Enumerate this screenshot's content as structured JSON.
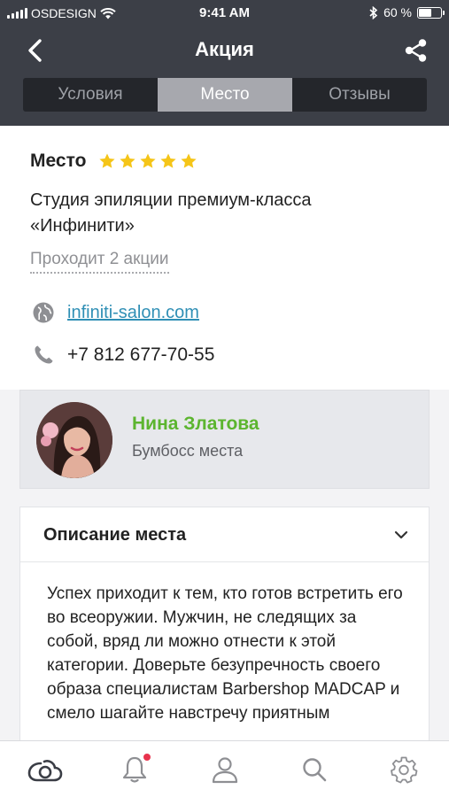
{
  "status_bar": {
    "carrier": "OSDESIGN",
    "time": "9:41 AM",
    "battery": "60 %"
  },
  "nav": {
    "title": "Акция"
  },
  "segments": [
    {
      "label": "Условия",
      "active": false
    },
    {
      "label": "Место",
      "active": true
    },
    {
      "label": "Отзывы",
      "active": false
    }
  ],
  "place": {
    "heading": "Место",
    "rating": 5,
    "name": "Студия эпиляции премиум-класса «Инфинити»",
    "promos_link": "Проходит 2 акции",
    "website": "infiniti-salon.com",
    "phone": "+7 812 677-70-55"
  },
  "boss": {
    "name": "Нина Златова",
    "role": "Бумбосс места"
  },
  "description": {
    "title": "Описание места",
    "text": "Успех приходит к тем, кто готов встретить его во всеоружии. Мужчин, не следящих за собой, вряд ли можно отнести к этой категории. Доверьте безупречность своего образа специалистам Barbershop MADCAP и смело шагайте навстречу приятным"
  },
  "tabbar": {
    "items": [
      "home-icon",
      "bell-icon",
      "profile-icon",
      "search-icon",
      "settings-icon"
    ],
    "notification_dot": true
  },
  "colors": {
    "header_bg": "#3c3f47",
    "accent_green": "#5cb52f",
    "link_blue": "#2f8fb5",
    "star_yellow": "#f5c518",
    "badge_red": "#e8334d"
  }
}
